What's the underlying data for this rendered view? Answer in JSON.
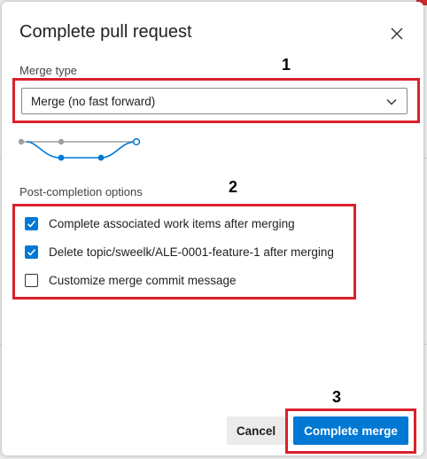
{
  "dialog": {
    "title": "Complete pull request",
    "merge_type_label": "Merge type",
    "merge_type_value": "Merge (no fast forward)",
    "post_completion_label": "Post-completion options",
    "options": [
      {
        "label": "Complete associated work items after merging",
        "checked": true
      },
      {
        "label": "Delete topic/sweelk/ALE-0001-feature-1 after merging",
        "checked": true
      },
      {
        "label": "Customize merge commit message",
        "checked": false
      }
    ],
    "cancel_label": "Cancel",
    "complete_label": "Complete merge"
  },
  "annotations": {
    "step1": "1",
    "step2": "2",
    "step3": "3"
  },
  "colors": {
    "accent": "#0078d4",
    "annotation_red": "#d9212b"
  },
  "icons": {
    "close": "close-icon",
    "dropdown": "chevron-down-icon",
    "graph": "merge-graph-icon",
    "check": "check-icon"
  }
}
